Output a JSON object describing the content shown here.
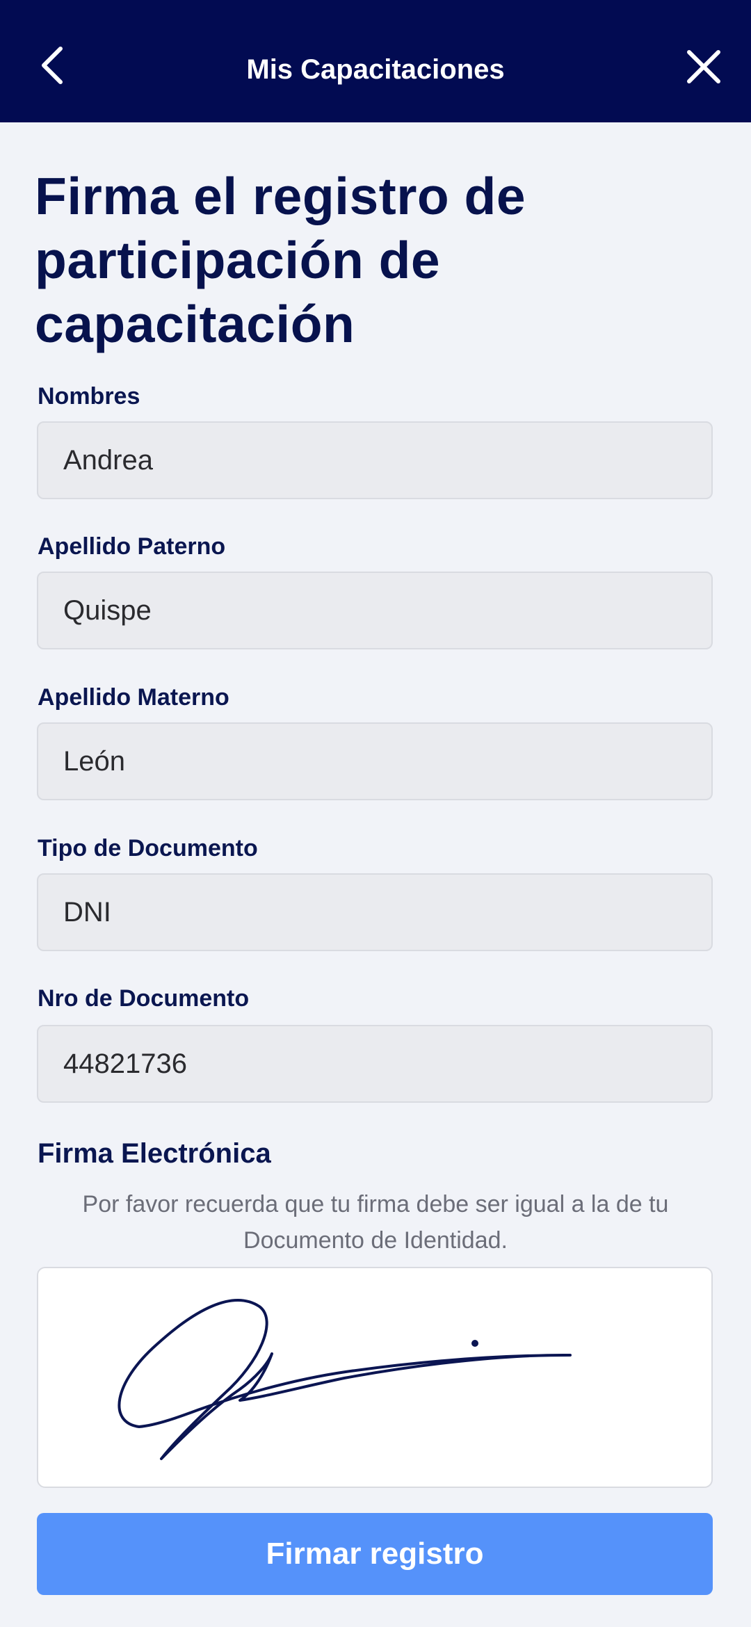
{
  "header": {
    "title": "Mis Capacitaciones",
    "back_icon": "chevron-left-icon",
    "close_icon": "close-icon",
    "background_color": "#020b52"
  },
  "page_title": "Firma el registro de participación de capacitación",
  "form": {
    "fields": [
      {
        "label": "Nombres",
        "value": "Andrea"
      },
      {
        "label": "Apellido Paterno",
        "value": "Quispe"
      },
      {
        "label": "Apellido Materno",
        "value": "León"
      },
      {
        "label": "Tipo de Documento",
        "value": "DNI"
      },
      {
        "label": "Nro de Documento",
        "value": "44821736"
      }
    ]
  },
  "signature": {
    "title": "Firma Electrónica",
    "note": "Por favor recuerda que tu firma debe ser igual a la de tu Documento de Identidad."
  },
  "submit": {
    "label": "Firmar registro",
    "color": "#5592fa"
  }
}
